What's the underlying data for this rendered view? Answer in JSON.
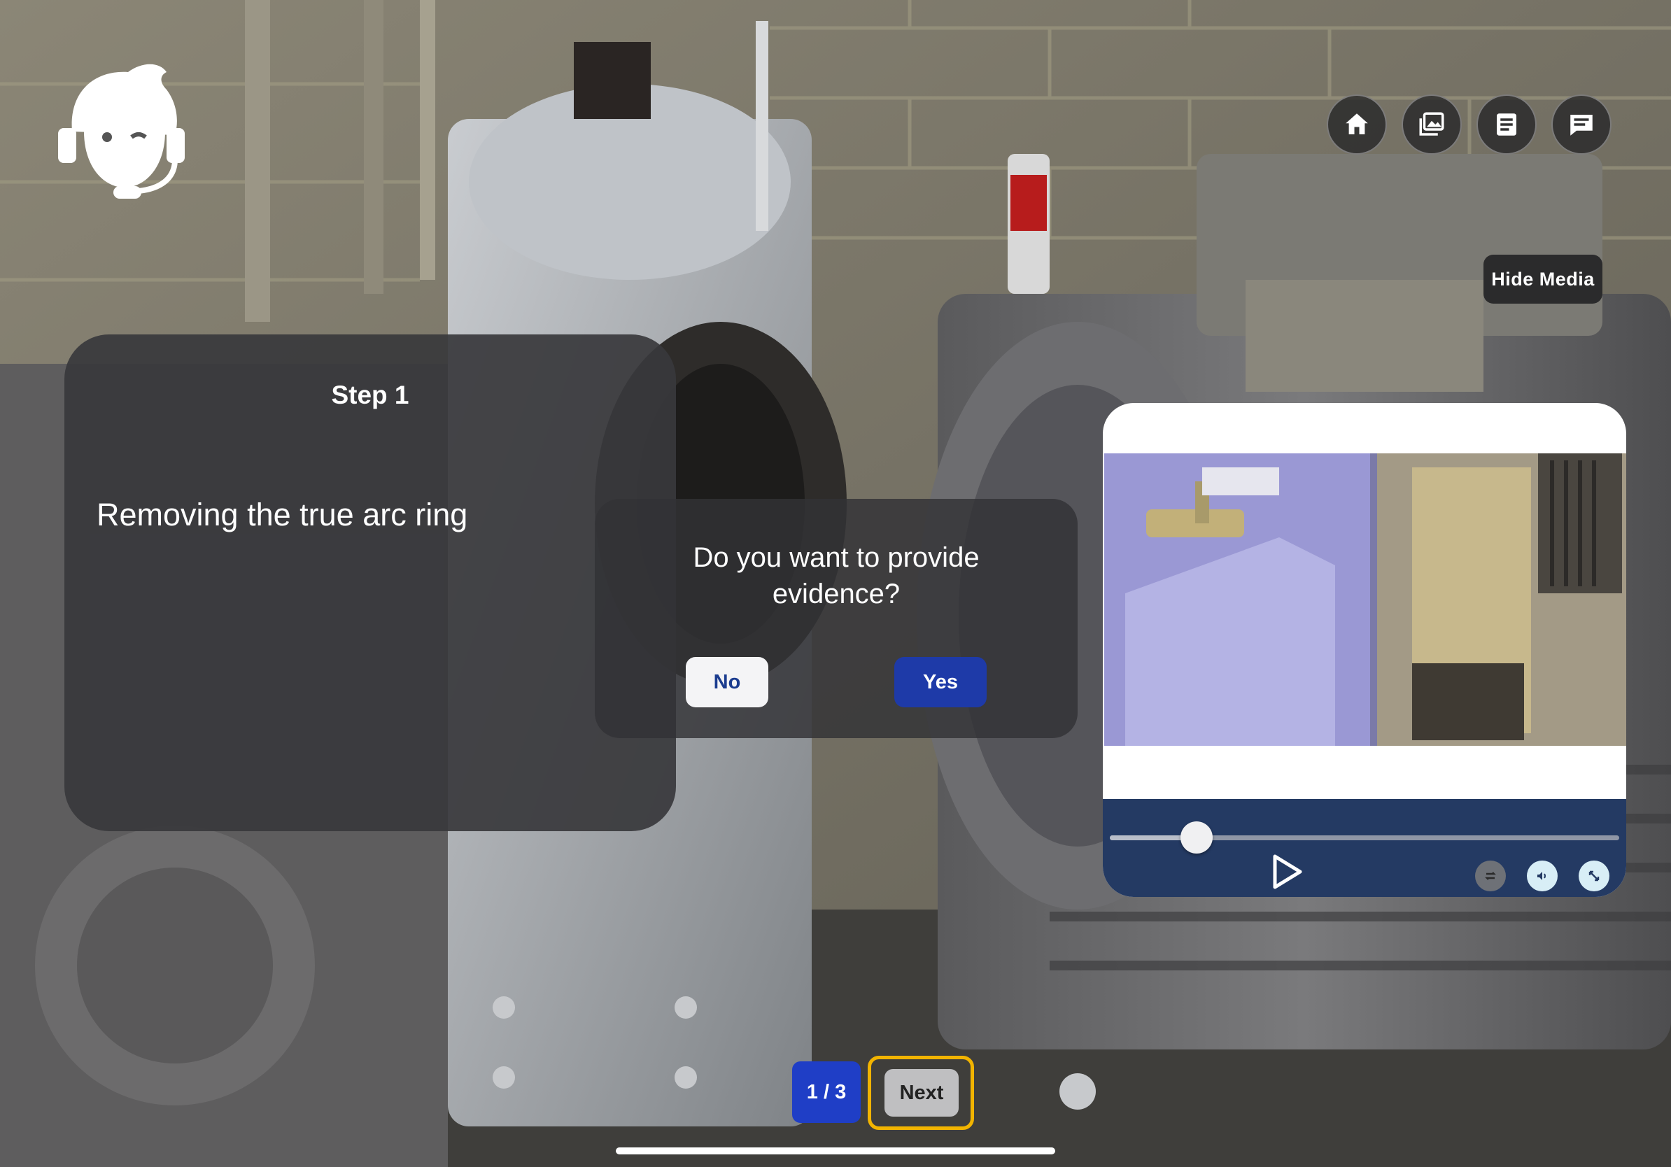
{
  "toolbar": {
    "icons": [
      "home-icon",
      "gallery-icon",
      "document-icon",
      "chat-icon"
    ]
  },
  "media": {
    "hide_label": "Hide Media",
    "progress": 0.17
  },
  "step": {
    "title": "Step 1",
    "description": "Removing the true arc ring"
  },
  "dialog": {
    "question": "Do you want to provide evidence?",
    "no_label": "No",
    "yes_label": "Yes"
  },
  "pager": {
    "indicator": "1 / 3",
    "next_label": "Next"
  },
  "colors": {
    "accent_blue": "#1e3aa8",
    "page_indicator": "#1f3ec6",
    "media_controls": "#243a63",
    "next_highlight": "#f2b400"
  }
}
